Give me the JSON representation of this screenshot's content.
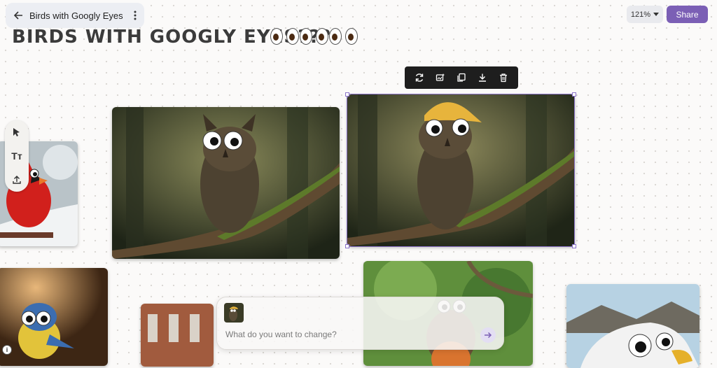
{
  "header": {
    "doc_title": "Birds with Googly Eyes",
    "zoom_label": "121%",
    "share_label": "Share"
  },
  "board": {
    "title": "BIRDS WITH GOOGLY EYES???",
    "title_emoji_icons": [
      "eyes-emoji-icon",
      "eyes-emoji-icon",
      "eyes-emoji-icon"
    ]
  },
  "image_toolbar": {
    "icons": [
      "regenerate-icon",
      "edit-image-icon",
      "duplicate-icon",
      "download-icon",
      "delete-icon"
    ]
  },
  "left_tools": {
    "icons": [
      "select-cursor-icon",
      "text-tool-icon",
      "upload-icon"
    ],
    "text_tool_label": "Tт"
  },
  "prompt": {
    "placeholder": "What do you want to change?"
  },
  "colors": {
    "accent": "#7b5fb5",
    "canvas_bg": "#fbfaf9",
    "toolbar_bg": "#1e1e1e"
  }
}
